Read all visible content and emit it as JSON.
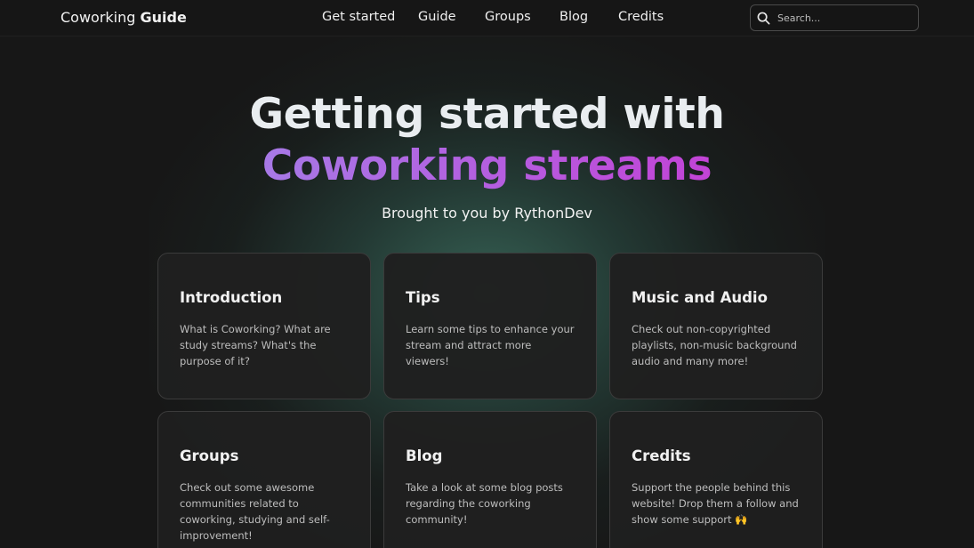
{
  "header": {
    "brand_prefix": "Coworking",
    "brand_strong": "Guide",
    "nav": [
      {
        "label": "Get started"
      },
      {
        "label": "Guide"
      },
      {
        "label": "Groups"
      },
      {
        "label": "Blog"
      },
      {
        "label": "Credits"
      }
    ],
    "search": {
      "placeholder": "Search...",
      "icon": "search-icon"
    }
  },
  "hero": {
    "title_line1": "Getting started with",
    "title_line2": "Coworking streams",
    "subtitle": "Brought to you by RythonDev",
    "gradient_colors": [
      "#a779e6",
      "#c243d6"
    ]
  },
  "cards": [
    {
      "title": "Introduction",
      "description": "What is Coworking? What are study streams? What's the purpose of it?"
    },
    {
      "title": "Tips",
      "description": "Learn some tips to enhance your stream and attract more viewers!"
    },
    {
      "title": "Music and Audio",
      "description": "Check out non-copyrighted playlists, non-music background audio and many more!"
    },
    {
      "title": "Groups",
      "description": "Check out some awesome communities related to coworking, studying and self-improvement!"
    },
    {
      "title": "Blog",
      "description": "Take a look at some blog posts regarding the coworking community!"
    },
    {
      "title": "Credits",
      "description": "Support the people behind this website! Drop them a follow and show some support 🙌"
    }
  ],
  "colors": {
    "background": "#171717",
    "glow": "#3c6e5f",
    "card": "#1f1f1f"
  }
}
